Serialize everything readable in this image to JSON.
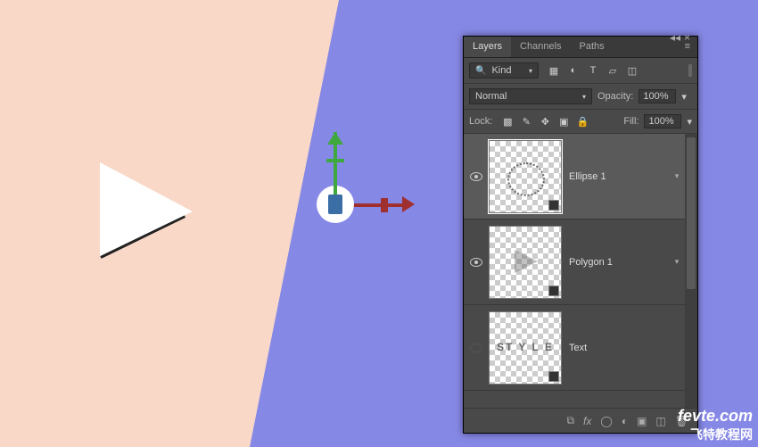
{
  "panel": {
    "tabs": [
      "Layers",
      "Channels",
      "Paths"
    ],
    "active_tab": 0,
    "filter": {
      "label": "Kind"
    },
    "blend": {
      "mode": "Normal",
      "opacity_label": "Opacity:",
      "opacity_value": "100%"
    },
    "lock": {
      "label": "Lock:",
      "fill_label": "Fill:",
      "fill_value": "100%"
    },
    "layers": [
      {
        "name": "Ellipse 1",
        "visible": true,
        "selected": true,
        "thumb": "ellipse"
      },
      {
        "name": "Polygon 1",
        "visible": true,
        "selected": false,
        "thumb": "polygon"
      },
      {
        "name": "Text",
        "visible": false,
        "selected": false,
        "thumb": "text",
        "thumb_text": "ST Y\nL E"
      }
    ],
    "footer_icons": [
      "link",
      "fx",
      "mask",
      "adjust",
      "group",
      "new",
      "trash"
    ]
  },
  "watermark": {
    "line1": "fevte.com",
    "line2": "飞特教程网"
  }
}
